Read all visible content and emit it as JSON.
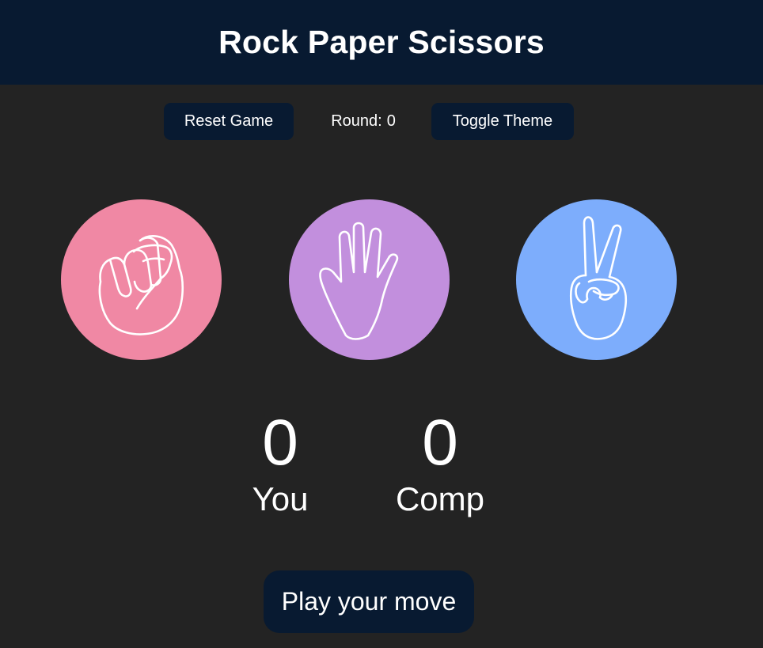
{
  "header": {
    "title": "Rock Paper Scissors"
  },
  "controls": {
    "reset_label": "Reset Game",
    "round_label": "Round:",
    "round_value": "0",
    "theme_label": "Toggle Theme"
  },
  "choices": [
    {
      "name": "rock",
      "icon": "fist-icon",
      "color": "#f088a4"
    },
    {
      "name": "paper",
      "icon": "open-hand-icon",
      "color": "#c28fdd"
    },
    {
      "name": "scissors",
      "icon": "peace-sign-icon",
      "color": "#7dadfc"
    }
  ],
  "scores": {
    "you": {
      "value": "0",
      "label": "You"
    },
    "comp": {
      "value": "0",
      "label": "Comp"
    }
  },
  "status": {
    "message": "Play your move"
  },
  "colors": {
    "background": "#232323",
    "header": "#081a31",
    "button": "#081a31",
    "text": "#ffffff"
  }
}
